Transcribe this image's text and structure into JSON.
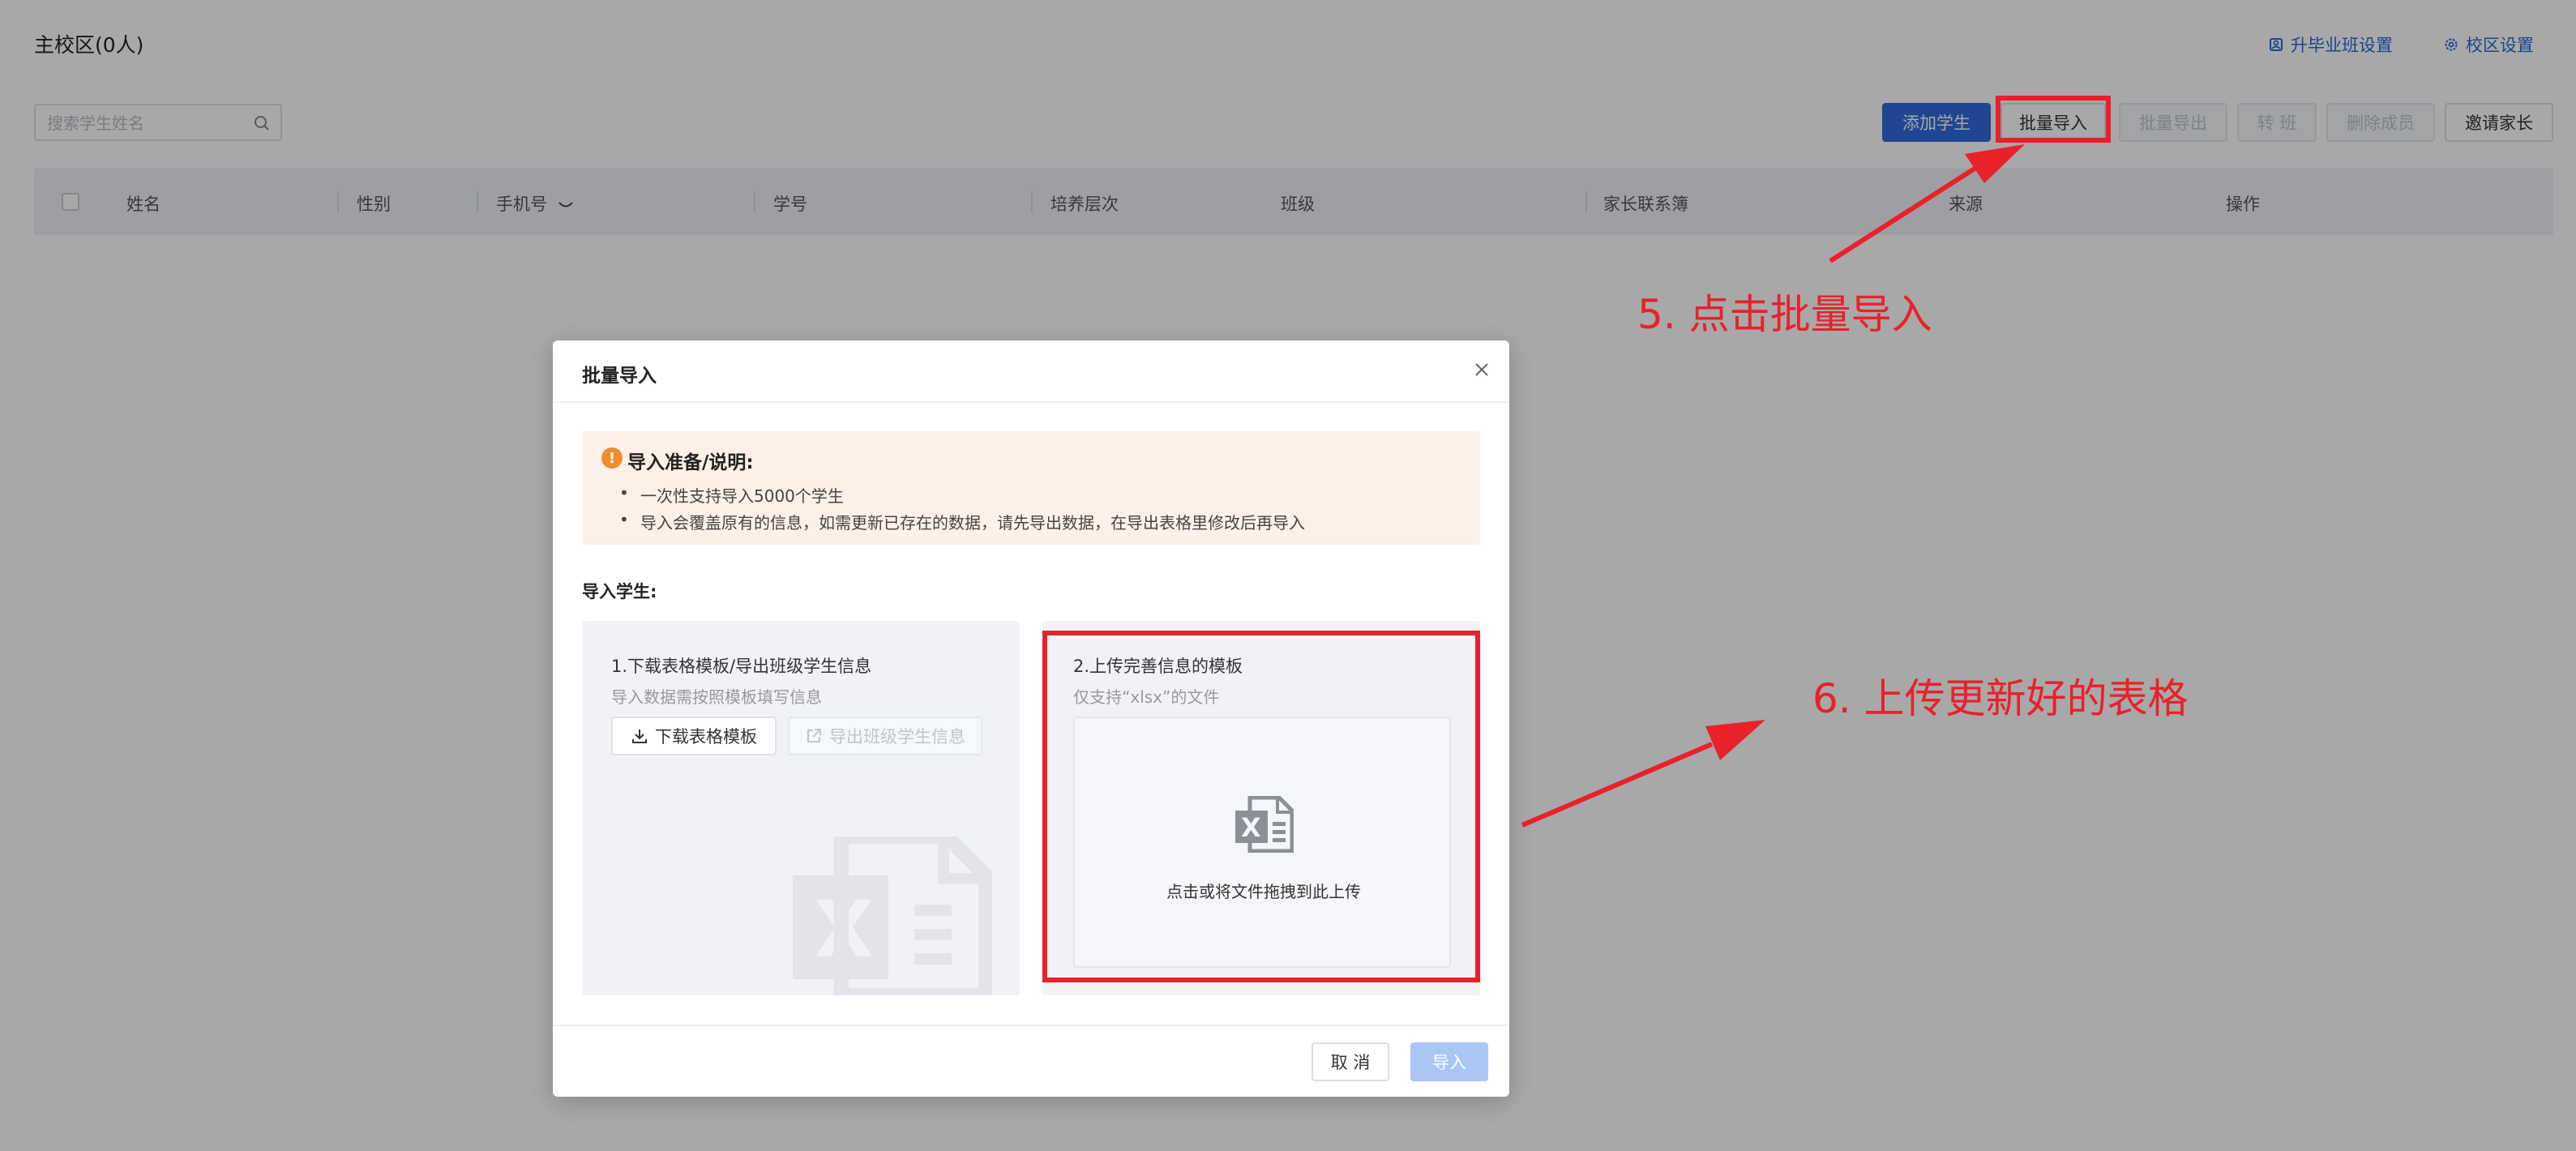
{
  "page": {
    "title": "主校区(0人)",
    "links": {
      "graduation": "升毕业班设置",
      "campus": "校区设置"
    },
    "search": {
      "placeholder": "搜索学生姓名"
    },
    "toolbar": {
      "add_student": "添加学生",
      "batch_import": "批量导入",
      "batch_export": "批量导出",
      "transfer_class": "转 班",
      "delete_member": "删除成员",
      "invite_parent": "邀请家长"
    },
    "table_headers": [
      "姓名",
      "性别",
      "手机号",
      "学号",
      "培养层次",
      "班级",
      "家长联系簿",
      "来源",
      "操作"
    ]
  },
  "annotations": {
    "step5": "5. 点击批量导入",
    "step6": "6. 上传更新好的表格",
    "color": "#e8212b"
  },
  "modal": {
    "title": "批量导入",
    "notice": {
      "title": "导入准备/说明:",
      "items": [
        "一次性支持导入5000个学生",
        "导入会覆盖原有的信息，如需更新已存在的数据，请先导出数据，在导出表格里修改后再导入"
      ]
    },
    "section_label": "导入学生:",
    "left_card": {
      "heading": "1.下载表格模板/导出班级学生信息",
      "sub": "导入数据需按照模板填写信息",
      "download_btn": "下载表格模板",
      "export_btn": "导出班级学生信息"
    },
    "right_card": {
      "heading": "2.上传完善信息的模板",
      "sub": "仅支持“xlsx”的文件",
      "drop_text": "点击或将文件拖拽到此上传"
    },
    "footer": {
      "cancel": "取 消",
      "import": "导入"
    }
  }
}
